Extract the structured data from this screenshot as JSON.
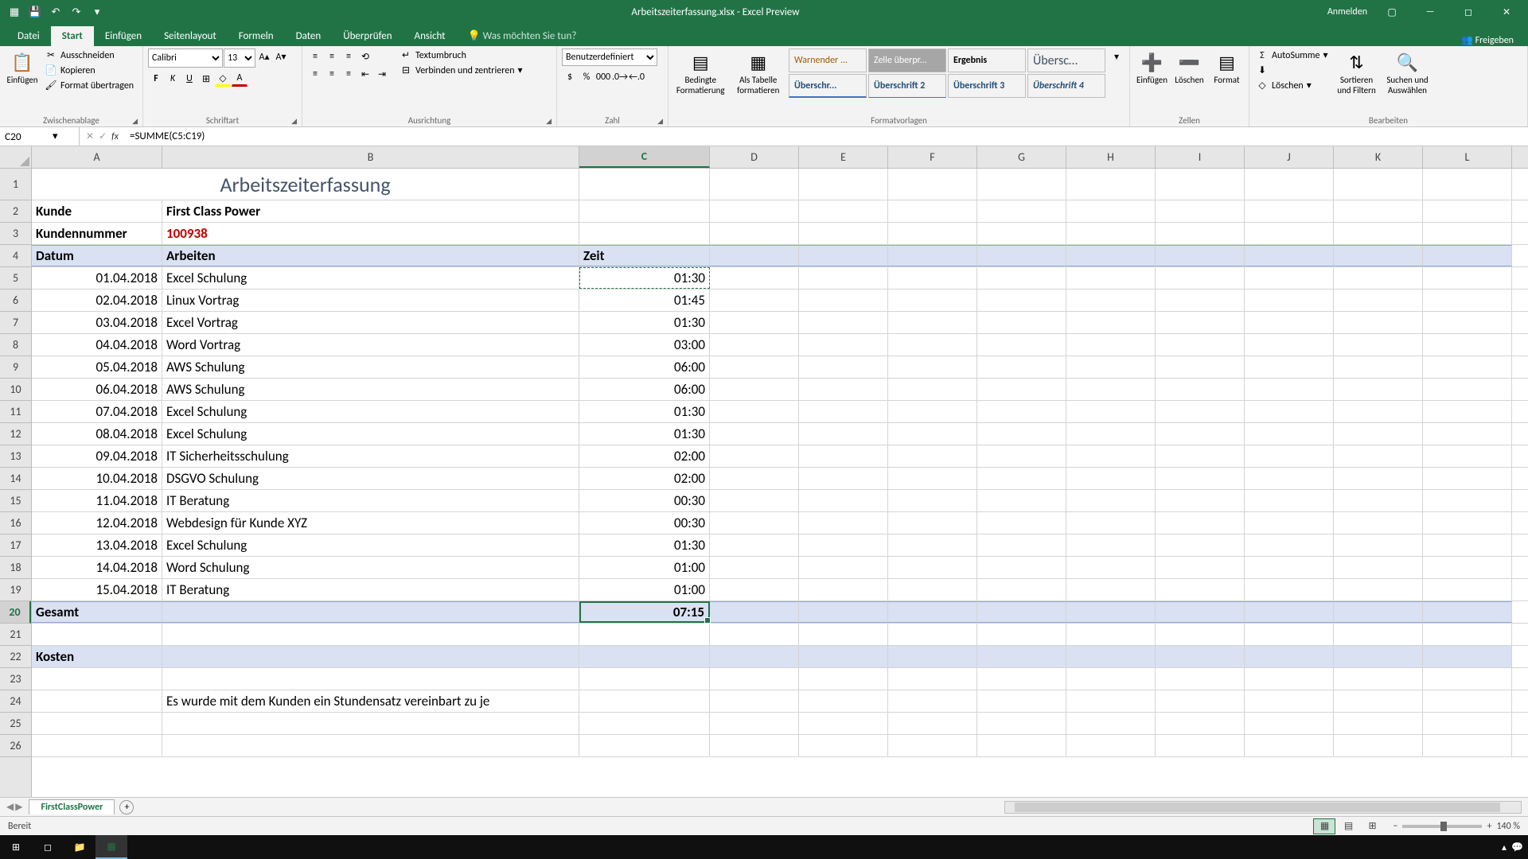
{
  "title": "Arbeitszeiterfassung.xlsx - Excel Preview",
  "signin": "Anmelden",
  "tabs": {
    "datei": "Datei",
    "start": "Start",
    "einfuegen": "Einfügen",
    "seitenlayout": "Seitenlayout",
    "formeln": "Formeln",
    "daten": "Daten",
    "ueberpruefen": "Überprüfen",
    "ansicht": "Ansicht",
    "tellme": "Was möchten Sie tun?",
    "freigeben": "Freigeben"
  },
  "ribbon": {
    "zwischenablage": {
      "label": "Zwischenablage",
      "einfuegen": "Einfügen",
      "ausschneiden": "Ausschneiden",
      "kopieren": "Kopieren",
      "format": "Format übertragen"
    },
    "schriftart": {
      "label": "Schriftart",
      "font": "Calibri",
      "size": "13"
    },
    "ausrichtung": {
      "label": "Ausrichtung",
      "textumbruch": "Textumbruch",
      "verbinden": "Verbinden und zentrieren"
    },
    "zahl": {
      "label": "Zahl",
      "format": "Benutzerdefiniert"
    },
    "formatvorlagen": {
      "label": "Formatvorlagen",
      "bedingte": "Bedingte Formatierung",
      "tabelle": "Als Tabelle formatieren",
      "warnender": "Warnender ...",
      "zelle": "Zelle überpr...",
      "ergebnis": "Ergebnis",
      "uebersc": "Übersc…",
      "h1": "Überschr...",
      "h2": "Überschrift 2",
      "h3": "Überschrift 3",
      "h4": "Überschrift 4"
    },
    "zellen": {
      "label": "Zellen",
      "einf": "Einfügen",
      "loesch": "Löschen",
      "format": "Format"
    },
    "bearbeiten": {
      "label": "Bearbeiten",
      "auto": "AutoSumme",
      "loesch": "Löschen",
      "sort": "Sortieren und Filtern",
      "such": "Suchen und Auswählen"
    }
  },
  "namebox": "C20",
  "formula": "=SUMME(C5:C19)",
  "colHeaders": [
    "A",
    "B",
    "C",
    "D",
    "E",
    "F",
    "G",
    "H",
    "I",
    "J",
    "K",
    "L"
  ],
  "rowCount": 26,
  "chart_data": {
    "type": "table",
    "title": "Arbeitszeiterfassung",
    "kunde_label": "Kunde",
    "kunde_value": "First Class Power",
    "kundennr_label": "Kundennummer",
    "kundennr_value": "100938",
    "columns": {
      "datum": "Datum",
      "arbeiten": "Arbeiten",
      "zeit": "Zeit"
    },
    "rows": [
      {
        "datum": "01.04.2018",
        "arbeiten": "Excel Schulung",
        "zeit": "01:30"
      },
      {
        "datum": "02.04.2018",
        "arbeiten": "Linux Vortrag",
        "zeit": "01:45"
      },
      {
        "datum": "03.04.2018",
        "arbeiten": "Excel Vortrag",
        "zeit": "01:30"
      },
      {
        "datum": "04.04.2018",
        "arbeiten": "Word Vortrag",
        "zeit": "03:00"
      },
      {
        "datum": "05.04.2018",
        "arbeiten": "AWS Schulung",
        "zeit": "06:00"
      },
      {
        "datum": "06.04.2018",
        "arbeiten": "AWS Schulung",
        "zeit": "06:00"
      },
      {
        "datum": "07.04.2018",
        "arbeiten": "Excel Schulung",
        "zeit": "01:30"
      },
      {
        "datum": "08.04.2018",
        "arbeiten": "Excel Schulung",
        "zeit": "01:30"
      },
      {
        "datum": "09.04.2018",
        "arbeiten": "IT Sicherheitsschulung",
        "zeit": "02:00"
      },
      {
        "datum": "10.04.2018",
        "arbeiten": "DSGVO Schulung",
        "zeit": "02:00"
      },
      {
        "datum": "11.04.2018",
        "arbeiten": "IT Beratung",
        "zeit": "00:30"
      },
      {
        "datum": "12.04.2018",
        "arbeiten": "Webdesign für Kunde XYZ",
        "zeit": "00:30"
      },
      {
        "datum": "13.04.2018",
        "arbeiten": "Excel Schulung",
        "zeit": "01:30"
      },
      {
        "datum": "14.04.2018",
        "arbeiten": "Word Schulung",
        "zeit": "01:00"
      },
      {
        "datum": "15.04.2018",
        "arbeiten": "IT Beratung",
        "zeit": "01:00"
      }
    ],
    "gesamt_label": "Gesamt",
    "gesamt_value": "07:15",
    "kosten_label": "Kosten",
    "note": "Es wurde mit dem Kunden ein Stundensatz vereinbart zu je"
  },
  "sheet": {
    "name": "FirstClassPower"
  },
  "status": {
    "ready": "Bereit",
    "zoom": "140 %"
  }
}
